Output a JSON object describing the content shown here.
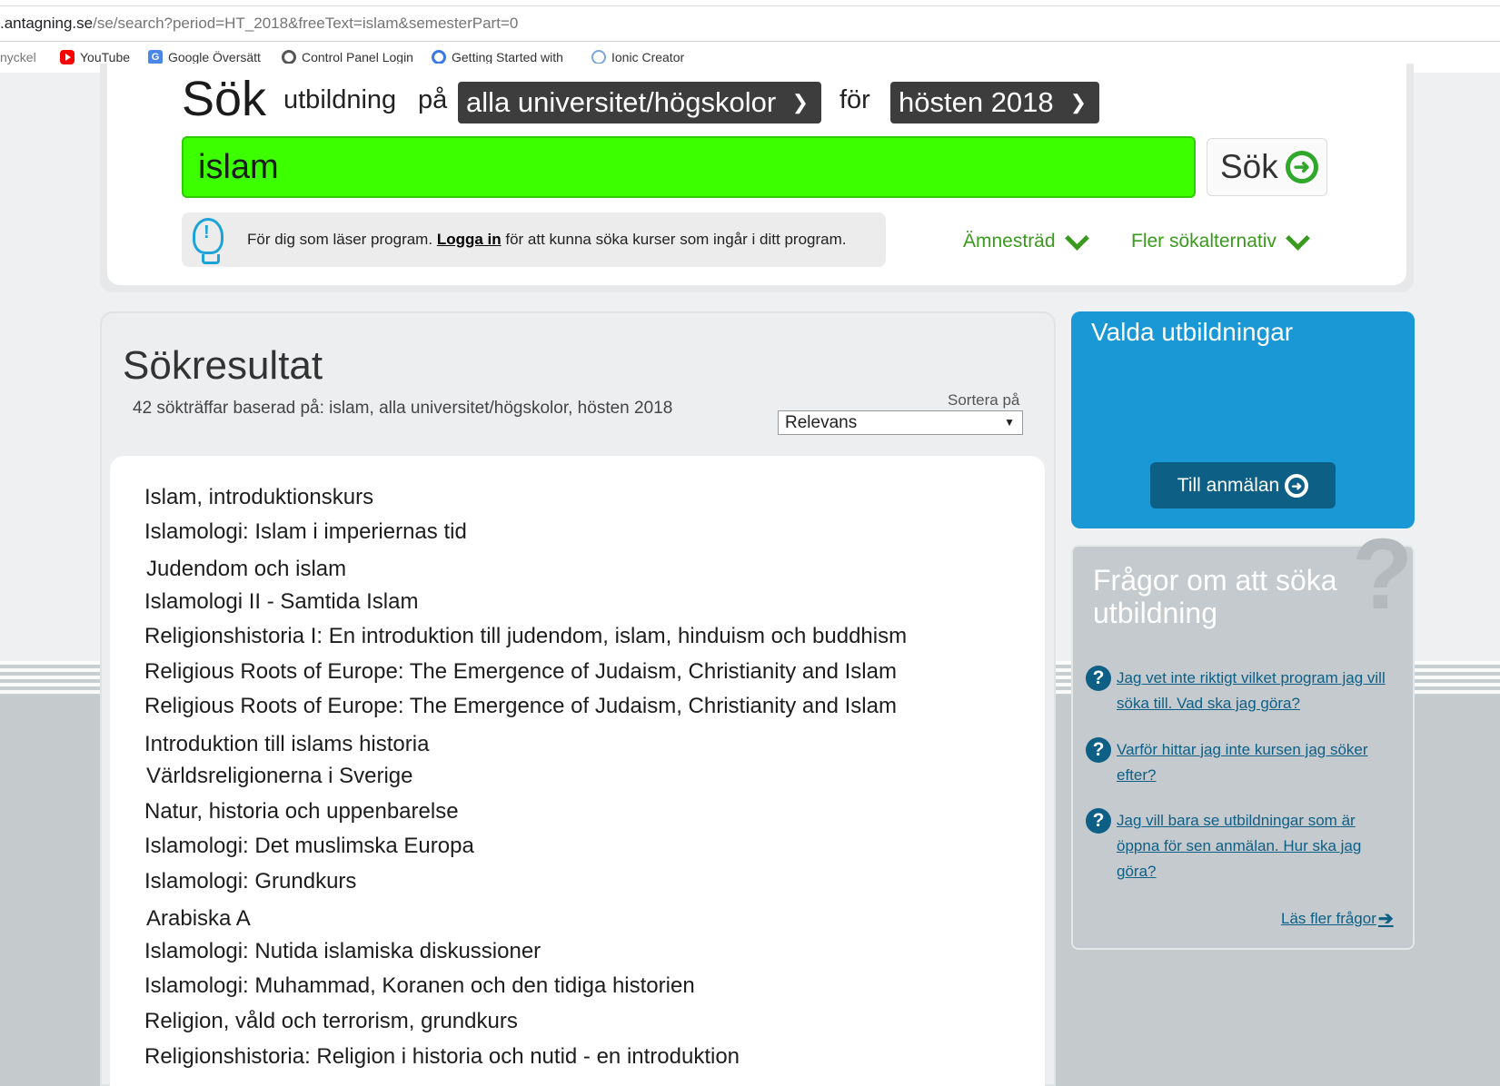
{
  "browser": {
    "url_host": ".antagning.se",
    "url_path": "/se/search?period=HT_2018&freeText=islam&semesterPart=0",
    "bookmarks": [
      {
        "label": "nyckel",
        "icon": "bookmark-icon"
      },
      {
        "label": "YouTube",
        "icon": "youtube-icon"
      },
      {
        "label": "Google Översätt",
        "icon": "google-translate-icon"
      },
      {
        "label": "Control Panel Login",
        "icon": "control-panel-icon"
      },
      {
        "label": "Getting Started with",
        "icon": "getting-started-icon"
      },
      {
        "label": "Ionic Creator",
        "icon": "ionic-icon"
      }
    ]
  },
  "search": {
    "heading": "Sök",
    "label_utbildning": "utbildning",
    "label_pa": "på",
    "university_value": "alla universitet/högskolor",
    "label_for": "för",
    "semester_value": "hösten 2018",
    "query": "islam",
    "button_label": "Sök",
    "info_prefix": "För dig som läser program.",
    "info_link": "Logga in",
    "info_suffix": "för att kunna söka kurser som ingår i ditt program.",
    "subject_tree_label": "Ämnesträd",
    "more_options_label": "Fler sökalternativ"
  },
  "results": {
    "title": "Sökresultat",
    "summary": "42 sökträffar baserad på: islam, alla universitet/högskolor, hösten 2018",
    "sort_label": "Sortera på",
    "sort_value": "Relevans",
    "items": [
      "Islam, introduktionskurs",
      "Islamologi: Islam i imperiernas tid",
      "Judendom och islam",
      "Islamologi II - Samtida Islam",
      "Religionshistoria I: En introduktion till judendom, islam, hinduism och buddhism",
      "Religious Roots of Europe: The Emergence of Judaism, Christianity and Islam",
      "Religious Roots of Europe: The Emergence of Judaism, Christianity and Islam",
      "Introduktion till islams historia",
      "Världsreligionerna i Sverige",
      "Natur, historia och uppenbarelse",
      "Islamologi: Det muslimska Europa",
      "Islamologi: Grundkurs",
      "Arabiska A",
      "Islamologi: Nutida islamiska diskussioner",
      "Islamologi: Muhammad, Koranen och den tidiga historien",
      "Religion, våld och terrorism, grundkurs",
      "Religionshistoria: Religion i historia och nutid - en introduktion"
    ]
  },
  "selected": {
    "title": "Valda utbildningar",
    "button_label": "Till anmälan"
  },
  "faq": {
    "title": "Frågor om att söka utbildning",
    "questions": [
      "Jag vet inte riktigt vilket program jag vill söka till. Vad ska jag göra?",
      "Varför hittar jag inte kursen jag söker efter?",
      "Jag vill bara se utbildningar som är öppna för sen anmälan. Hur ska jag göra?"
    ],
    "more_label": "Läs fler frågor"
  },
  "colors": {
    "search_field": "#3cff00",
    "accent_green": "#3a9a1e",
    "panel_blue": "#1a97d5",
    "link_blue": "#0d5f86"
  }
}
